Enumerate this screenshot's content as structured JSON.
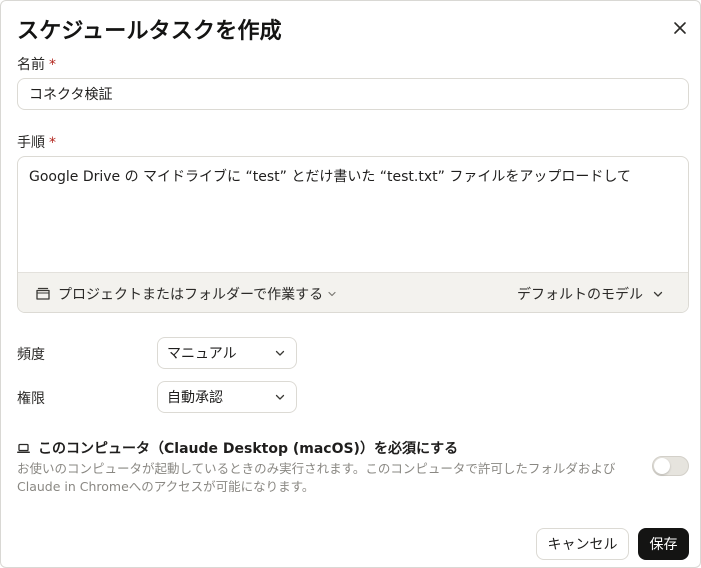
{
  "dialog": {
    "title": "スケジュールタスクを作成",
    "close_icon": "close-icon"
  },
  "name_field": {
    "label": "名前",
    "required_mark": "*",
    "value": "コネクタ検証"
  },
  "steps_field": {
    "label": "手順",
    "required_mark": "*",
    "value": "Google Drive の マイドライブに “test” とだけ書いた “test.txt” ファイルをアップロードして",
    "project_button": "プロジェクトまたはフォルダーで作業する",
    "model_button": "デフォルトのモデル"
  },
  "frequency": {
    "label": "頻度",
    "selected": "マニュアル"
  },
  "permission": {
    "label": "権限",
    "selected": "自動承認"
  },
  "computer_requirement": {
    "label": "このコンピュータ（Claude Desktop (macOS)）を必須にする",
    "description": "お使いのコンピュータが起動しているときのみ実行されます。このコンピュータで許可したフォルダおよび Claude in Chromeへのアクセスが可能になります。",
    "enabled": false
  },
  "footer": {
    "cancel_label": "キャンセル",
    "save_label": "保存"
  }
}
